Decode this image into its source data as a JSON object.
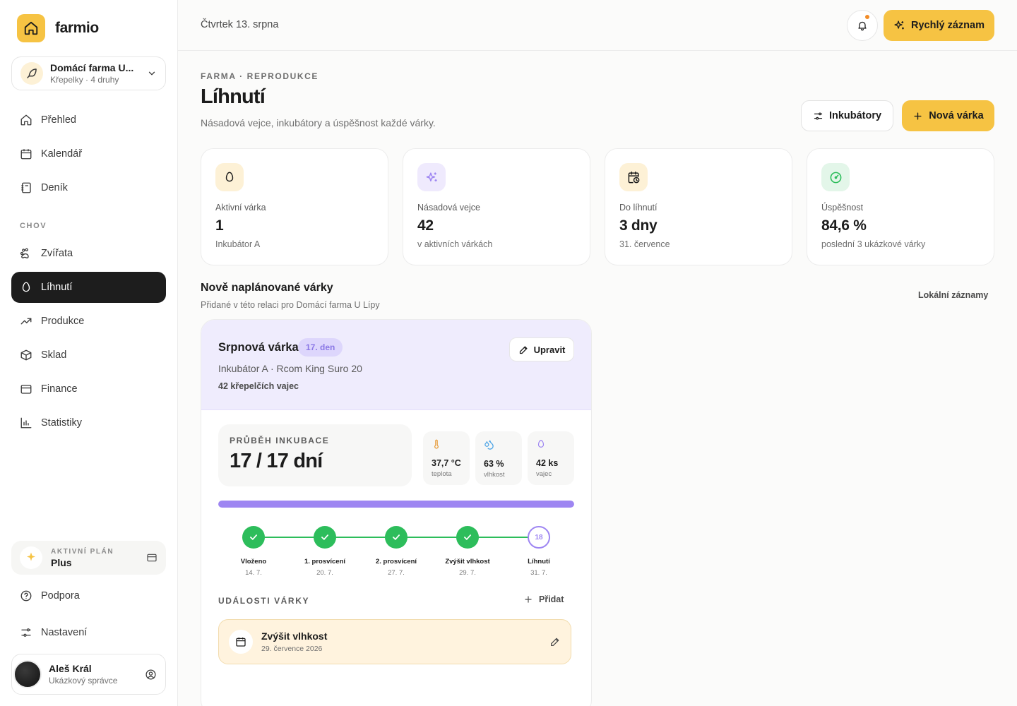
{
  "brand": {
    "name": "farmio",
    "icon": "home-icon"
  },
  "farm": {
    "name": "Domácí farma U...",
    "sub": "Křepelky · 4 druhy"
  },
  "nav": {
    "main": [
      {
        "label": "Přehled",
        "icon": "home-icon"
      },
      {
        "label": "Kalendář",
        "icon": "calendar-icon"
      },
      {
        "label": "Deník",
        "icon": "journal-icon"
      }
    ],
    "section_label": "CHOV",
    "chov": [
      {
        "label": "Zvířata",
        "icon": "paw-icon"
      },
      {
        "label": "Líhnutí",
        "icon": "egg-icon",
        "active": true
      },
      {
        "label": "Produkce",
        "icon": "trend-icon"
      },
      {
        "label": "Sklad",
        "icon": "box-icon"
      },
      {
        "label": "Finance",
        "icon": "wallet-icon"
      },
      {
        "label": "Statistiky",
        "icon": "bar-chart-icon"
      }
    ],
    "bottom": [
      {
        "label": "Podpora",
        "icon": "help-icon"
      },
      {
        "label": "Nastavení",
        "icon": "sliders-icon"
      }
    ]
  },
  "plan": {
    "label": "AKTIVNÍ PLÁN",
    "name": "Plus"
  },
  "user": {
    "name": "Aleš Král",
    "role": "Ukázkový správce"
  },
  "topbar": {
    "date": "Čtvrtek 13. srpna",
    "quick_label": "Rychlý záznam"
  },
  "header": {
    "breadcrumb": "FARMA · REPRODUKCE",
    "title": "Líhnutí",
    "subtitle": "Násadová vejce, inkubátory a úspěšnost každé várky.",
    "incubators_label": "Inkubátory",
    "new_batch_label": "Nová várka"
  },
  "stats": [
    {
      "label": "Aktivní várka",
      "value": "1",
      "note": "Inkubátor A",
      "icon": "egg-icon",
      "color": "#fdf1d6"
    },
    {
      "label": "Násadová vejce",
      "value": "42",
      "note": "v aktivních várkách",
      "icon": "sparkles-icon",
      "color": "#efeafd"
    },
    {
      "label": "Do líhnutí",
      "value": "3 dny",
      "note": "31. července",
      "icon": "calendar-clock-icon",
      "color": "#fdf1d6"
    },
    {
      "label": "Úspěšnost",
      "value": "84,6 %",
      "note": "poslední 3 ukázkové várky",
      "icon": "gauge-icon",
      "color": "#e3f6e9"
    }
  ],
  "section": {
    "title": "Nově naplánované várky",
    "subtitle": "Přidané v této relaci pro Domácí farma U Lípy",
    "link": "Lokální záznamy"
  },
  "batch": {
    "name": "Srpnová várka",
    "day": "17. den",
    "edit_label": "Upravit",
    "incubator": "Inkubátor A · Rcom King Suro 20",
    "eggs": "42 křepelčích vajec",
    "progress_label": "PRŮBĚH INKUBACE",
    "progress_value": "17 / 17 dní",
    "progress_fraction": 1.0,
    "metrics": [
      {
        "value": "37,7 °C",
        "label": "teplota",
        "icon": "thermometer-icon"
      },
      {
        "value": "63 %",
        "label": "vlhkost",
        "icon": "droplets-icon"
      },
      {
        "value": "42 ks",
        "label": "vajec",
        "icon": "egg-icon"
      }
    ],
    "steps": [
      {
        "label": "Vloženo",
        "date": "14. 7.",
        "done": true
      },
      {
        "label": "1. prosvícení",
        "date": "20. 7.",
        "done": true
      },
      {
        "label": "2. prosvícení",
        "date": "27. 7.",
        "done": true
      },
      {
        "label": "Zvýšit vlhkost",
        "date": "29. 7.",
        "done": true
      },
      {
        "label": "Líhnutí",
        "date": "31. 7.",
        "done": false,
        "marker": "18"
      }
    ],
    "events_title": "UDÁLOSTI VÁRKY",
    "events_add": "Přidat",
    "events": [
      {
        "title": "Zvýšit vlhkost",
        "date": "29. července 2026"
      }
    ]
  },
  "colors": {
    "accent": "#f6c343",
    "dark": "#1d1d1d",
    "purple": "#9e86f2",
    "green": "#2dbd5b"
  }
}
